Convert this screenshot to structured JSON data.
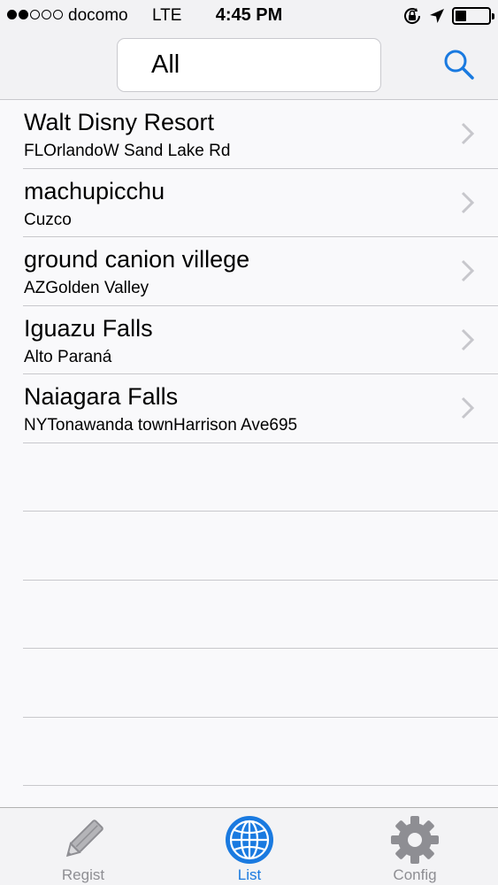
{
  "status_bar": {
    "signal_filled": 2,
    "signal_total": 5,
    "carrier": "docomo",
    "network": "LTE",
    "time": "4:45 PM",
    "icons": [
      "orientation-lock-icon",
      "location-arrow-icon",
      "battery-icon"
    ]
  },
  "nav": {
    "segment_label": "All",
    "search_icon": "search-icon"
  },
  "list": {
    "items": [
      {
        "title": "Walt Disny Resort",
        "subtitle": "FLOrlandoW Sand Lake Rd"
      },
      {
        "title": "machupicchu",
        "subtitle": "Cuzco"
      },
      {
        "title": "ground canion villege",
        "subtitle": "AZGolden Valley"
      },
      {
        "title": "Iguazu Falls",
        "subtitle": "Alto Paraná"
      },
      {
        "title": "Naiagara Falls",
        "subtitle": "NYTonawanda townHarrison Ave695"
      }
    ]
  },
  "tabbar": {
    "tabs": [
      {
        "label": "Regist",
        "icon": "pencil-icon",
        "active": false
      },
      {
        "label": "List",
        "icon": "globe-icon",
        "active": true
      },
      {
        "label": "Config",
        "icon": "gear-icon",
        "active": false
      }
    ]
  },
  "colors": {
    "accent": "#1a7ae0",
    "inactive": "#8e8e93",
    "separator": "#c8c8cc"
  }
}
